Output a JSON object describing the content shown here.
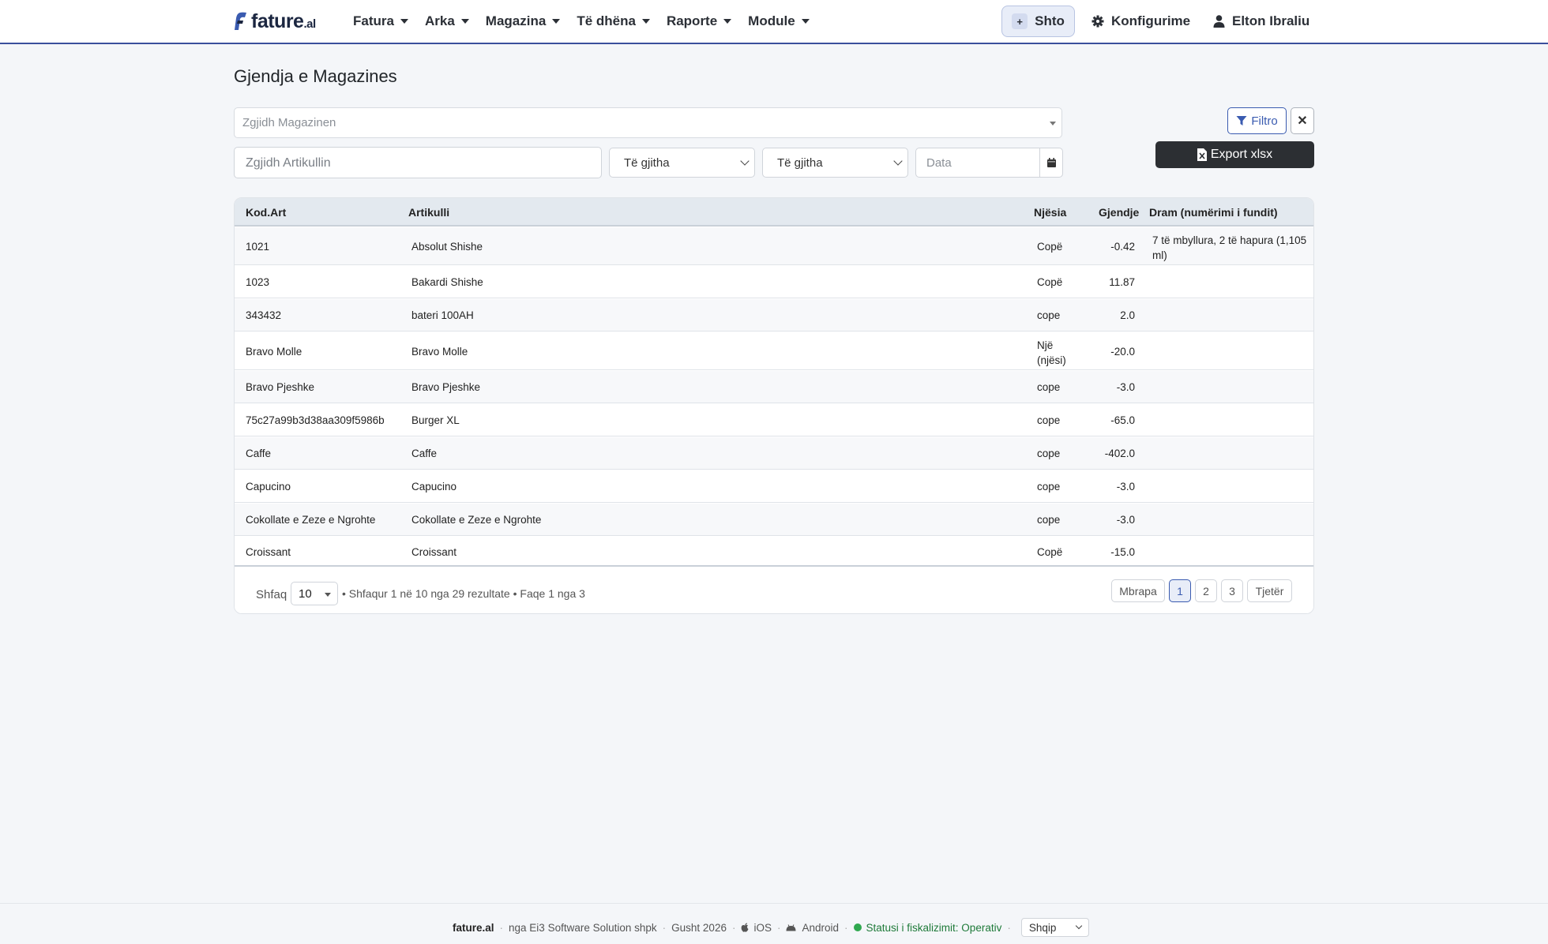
{
  "brand": {
    "name": "fature",
    "suffix": ".al"
  },
  "nav": {
    "items": [
      {
        "label": "Fatura"
      },
      {
        "label": "Arka"
      },
      {
        "label": "Magazina"
      },
      {
        "label": "Të dhëna"
      },
      {
        "label": "Raporte"
      },
      {
        "label": "Module"
      }
    ],
    "add_label": "Shto",
    "config_label": "Konfigurime",
    "user_label": "Elton Ibraliu"
  },
  "page": {
    "title": "Gjendja e Magazines"
  },
  "filters": {
    "warehouse_placeholder": "Zgjidh Magazinen",
    "article_placeholder": "Zgjidh Artikullin",
    "select1_value": "Të gjitha",
    "select2_value": "Të gjitha",
    "date_placeholder": "Data",
    "filter_label": "Filtro",
    "clear_label": "✕",
    "export_label": "Export xlsx"
  },
  "table": {
    "headers": {
      "code": "Kod.Art",
      "article": "Artikulli",
      "unit": "Njësia",
      "stock": "Gjendje",
      "dram": "Dram (numërimi i fundit)"
    },
    "rows": [
      {
        "code": "1021",
        "article": "Absolut Shishe",
        "unit": "Copë",
        "stock": "-0.42",
        "dram": "7 të mbyllura, 2 të hapura (1,105 ml)"
      },
      {
        "code": "1023",
        "article": "Bakardi Shishe",
        "unit": "Copë",
        "stock": "11.87",
        "dram": ""
      },
      {
        "code": "343432",
        "article": "bateri 100AH",
        "unit": "cope",
        "stock": "2.0",
        "dram": ""
      },
      {
        "code": "Bravo Molle",
        "article": "Bravo Molle",
        "unit": "Një (njësi)",
        "stock": "-20.0",
        "dram": ""
      },
      {
        "code": "Bravo Pjeshke",
        "article": "Bravo Pjeshke",
        "unit": "cope",
        "stock": "-3.0",
        "dram": ""
      },
      {
        "code": "75c27a99b3d38aa309f5986b",
        "article": "Burger XL",
        "unit": "cope",
        "stock": "-65.0",
        "dram": ""
      },
      {
        "code": "Caffe",
        "article": "Caffe",
        "unit": "cope",
        "stock": "-402.0",
        "dram": ""
      },
      {
        "code": "Capucino",
        "article": "Capucino",
        "unit": "cope",
        "stock": "-3.0",
        "dram": ""
      },
      {
        "code": "Cokollate e Zeze e Ngrohte",
        "article": "Cokollate e Zeze e Ngrohte",
        "unit": "cope",
        "stock": "-3.0",
        "dram": ""
      },
      {
        "code": "Croissant",
        "article": "Croissant",
        "unit": "Copë",
        "stock": "-15.0",
        "dram": ""
      }
    ]
  },
  "pagination": {
    "show_label": "Shfaq",
    "page_size": "10",
    "info": "• Shfaqur 1 në 10 nga 29 rezultate • Faqe 1 nga 3",
    "prev_label": "Mbrapa",
    "pages": [
      "1",
      "2",
      "3"
    ],
    "next_label": "Tjetër"
  },
  "footer": {
    "brand": "fature.al",
    "company": "nga Ei3 Software Solution shpk",
    "date": "Gusht 2026",
    "ios": "iOS",
    "android": "Android",
    "status": "Statusi i fiskalizimit: Operativ",
    "language": "Shqip"
  },
  "colors": {
    "accent": "#3a5bb0",
    "nav_border": "#3a4f9c",
    "export_bg": "#2c2f33",
    "status_ok": "#2fa84f"
  }
}
